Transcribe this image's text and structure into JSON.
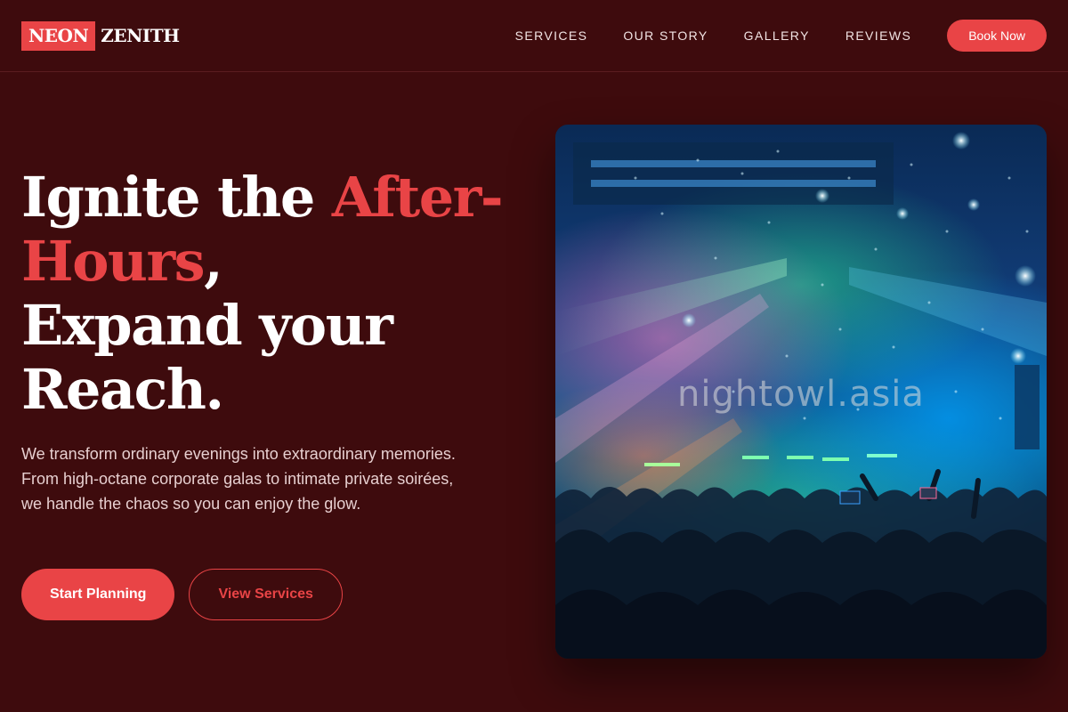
{
  "header": {
    "logo_first": "NEON",
    "logo_second": "ZENITH",
    "nav": [
      {
        "label": "SERVICES"
      },
      {
        "label": "OUR STORY"
      },
      {
        "label": "GALLERY"
      },
      {
        "label": "REVIEWS"
      }
    ],
    "cta_label": "Book Now"
  },
  "hero": {
    "title_part1": "Ignite the ",
    "title_accent": "After-Hours",
    "title_part2": ",",
    "title_part3": "Expand your Reach.",
    "description": "We transform ordinary evenings into extraordinary memories. From high-octane corporate galas to intimate private soirées, we handle the chaos so you can enjoy the glow.",
    "primary_button": "Start Planning",
    "secondary_button": "View Services",
    "image_watermark": "nightowl.asia"
  },
  "colors": {
    "background": "#3e0b0d",
    "accent": "#e94446",
    "text": "#ffffff",
    "muted_text": "#e7cfd0"
  },
  "icons": [
    "concert-photo"
  ]
}
